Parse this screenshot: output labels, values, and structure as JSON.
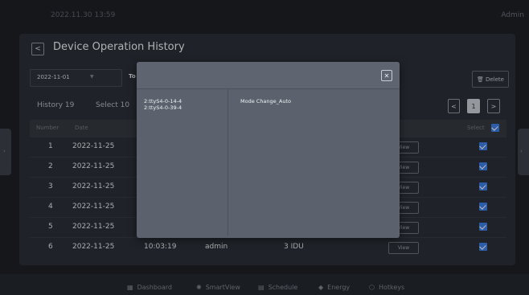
{
  "status_bar": {
    "datetime": "2022.11.30  13:59",
    "user": "Admin"
  },
  "page": {
    "back_icon": "chevron-left-icon",
    "title": "Device Operation History"
  },
  "filter": {
    "start_date": "2022-11-01",
    "to_label": "To",
    "delete_label": "Delete"
  },
  "summary": {
    "history_label": "History 19",
    "select_label": "Select 10"
  },
  "pagination": {
    "prev": "<",
    "current": "1",
    "next": ">"
  },
  "table": {
    "headers": {
      "number": "Number",
      "date": "Date",
      "select": "Select"
    },
    "rows": [
      {
        "number": "1",
        "date": "2022-11-25",
        "view": "View",
        "checked": true
      },
      {
        "number": "2",
        "date": "2022-11-25",
        "view": "View",
        "checked": true
      },
      {
        "number": "3",
        "date": "2022-11-25",
        "view": "View",
        "checked": true
      },
      {
        "number": "4",
        "date": "2022-11-25",
        "view": "View",
        "checked": true
      },
      {
        "number": "5",
        "date": "2022-11-25",
        "view": "View",
        "checked": true
      },
      {
        "number": "6",
        "date": "2022-11-25",
        "time": "10:03:19",
        "user": "admin",
        "device": "3 IDU",
        "view": "View",
        "checked": true
      }
    ]
  },
  "modal": {
    "close_icon": "close-icon",
    "devices": [
      "2:ttyS4-0-14-4",
      "2:ttyS4-0-39-4"
    ],
    "operation": "Mode Change_Auto"
  },
  "bottom_nav": [
    {
      "label": "Dashboard",
      "icon": "dashboard-icon"
    },
    {
      "label": "SmartView",
      "icon": "smartview-icon"
    },
    {
      "label": "Schedule",
      "icon": "schedule-icon"
    },
    {
      "label": "Energy",
      "icon": "energy-icon"
    },
    {
      "label": "Hotkeys",
      "icon": "hotkeys-icon"
    }
  ],
  "colors": {
    "accent": "#3d7be0",
    "panel": "#2a2f37",
    "modal": "#5b626d"
  }
}
